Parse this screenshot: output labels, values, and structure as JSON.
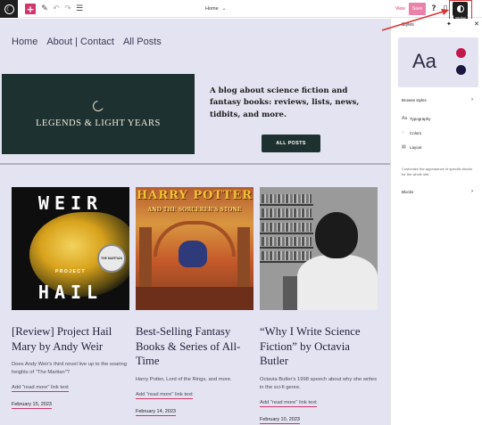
{
  "toolbar": {
    "doc_title": "Home",
    "view_label": "View",
    "save_label": "Save",
    "styles_tooltip": "Styles",
    "colors": {
      "accent": "#d2356b",
      "highlight": "#d63638"
    }
  },
  "site": {
    "nav": [
      "Home",
      "About | Contact",
      "All Posts"
    ],
    "title": "LEGENDS & LIGHT YEARS",
    "tagline": "A blog about science fiction and fantasy books: reviews, lists, news, tidbits, and more.",
    "cta_label": "ALL POSTS"
  },
  "posts": [
    {
      "title": "[Review] Project Hail Mary by Andy Weir",
      "excerpt": "Does Andy Weir's third novel live up to the soaring heights of \"The Martian\"?",
      "more": "Add \"read more\" link text",
      "date": "February 15, 2023",
      "cover": {
        "top": "WEIR",
        "mid": "PROJECT",
        "bottom": "HAIL",
        "badge": "THE MARTIAN"
      }
    },
    {
      "title": "Best-Selling Fantasy Books & Series of All-Time",
      "excerpt": "Harry Potter, Lord of the Rings, and more.",
      "more": "Add \"read more\" link text",
      "date": "February 14, 2023",
      "cover": {
        "top": "HARRY POTTER",
        "sub": "AND THE SORCERER'S STONE"
      }
    },
    {
      "title": "“Why I Write Science Fiction” by Octavia Butler",
      "excerpt": "Octavia Butler's 1998 speech about why she writes in the sci-fi genre.",
      "more": "Add \"read more\" link text",
      "date": "February 10, 2023"
    }
  ],
  "sidebar": {
    "header": "Styles",
    "preview_text": "Aa",
    "preview_colors": [
      "#c2184a",
      "#1a1740"
    ],
    "browse": "Browse styles",
    "typography": "Typography",
    "colors": "Colors",
    "layout": "Layout",
    "description": "Customize the appearance of specific blocks for the whole site.",
    "blocks": "Blocks"
  }
}
